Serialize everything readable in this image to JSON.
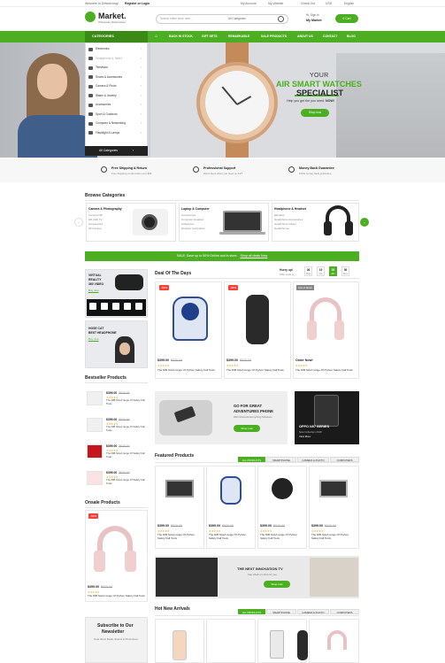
{
  "topbar": {
    "welcome": "Welcome to Default msg!",
    "register": "Register or Login",
    "account": "My Account",
    "wishlist": "My Wishlist",
    "checkout": "Check Out",
    "currency": "USD",
    "language": "English"
  },
  "header": {
    "logo_name": "Market.",
    "logo_tagline": "Wholesale Marketplace",
    "search_placeholder": "Search entire store here...",
    "search_category": "All Categories",
    "greeting": "Hi, Sign In",
    "account_label": "My Market",
    "cart_label": "0 Cart"
  },
  "nav": {
    "categories_label": "CATEGORIES",
    "items": [
      "BACK IN STOCK",
      "GIFT SETS",
      "REMARKABLE",
      "SALE PRODUCTS",
      "ABOUT US",
      "CONTACT",
      "BLOG"
    ]
  },
  "category_menu": {
    "items": [
      "Electronics",
      "Smartphone & Tablet",
      "Television",
      "Shoes & Accessories",
      "Camera & Photo",
      "Watch & Jewelry",
      "Accessories",
      "Sport & Outdoors",
      "Computer & Networking",
      "Flashlight & Lamps"
    ],
    "all_categories": "All Categories"
  },
  "hero": {
    "line1": "YOUR",
    "line2": "AIR SMART WATCHES",
    "line3": "SPECIALIST",
    "tagline_prefix": "Help you get the you need.",
    "tagline_emph": "NOW!",
    "button": "Shop now"
  },
  "features": [
    {
      "icon": "truck-icon",
      "title": "Free Shipping & Return",
      "sub": "Free Shipping on all orders over $99"
    },
    {
      "icon": "headset-icon",
      "title": "Professional Support",
      "sub": "We're there when you need us 24/7"
    },
    {
      "icon": "money-icon",
      "title": "Money Back Guarantee",
      "sub": "100% money back guarantee"
    }
  ],
  "browse": {
    "title": "Browse Categories",
    "boxes": [
      {
        "title": "Camera & Photography",
        "items": [
          "Camera HD",
          "HD LED TV",
          "Accessories",
          "All Camera"
        ]
      },
      {
        "title": "Laptop & Computer",
        "items": [
          "Accessories",
          "Computer Headset",
          "Categories",
          "Desktop Computers"
        ]
      },
      {
        "title": "Headphone & Headset",
        "items": [
          "Elevates",
          "Headphone Accessories",
          "Headphone Cases",
          "Headphones"
        ]
      }
    ]
  },
  "sale_bar": {
    "text": "SALE: Save up to 50% Online and in store.",
    "link": "Shop all deals Now"
  },
  "side_ads": {
    "vr_line1": "VIRTUAL",
    "vr_line2": "REALITY",
    "vr_line3": "360 VIDEO",
    "vr_cta": "Buy now",
    "hp_line1": "HOSE CAT",
    "hp_line2": "BEST HEADPHONE",
    "hp_cta": "Buy now"
  },
  "deal": {
    "title": "Deal Of The Days",
    "hurry": "Hurry up!",
    "offer_ends": "Offer ends in:",
    "countdown": [
      {
        "value": "06",
        "unit": "Days"
      },
      {
        "value": "19",
        "unit": "Hrs"
      },
      {
        "value": "02",
        "unit": "Min"
      },
      {
        "value": "56",
        "unit": "Secs"
      }
    ],
    "products": [
      {
        "badge": "-50%",
        "price": "$399.00",
        "old": "$520.00",
        "name": "The DIB SALA range Of Python Safety Fall Tools",
        "stars": "★★★★★"
      },
      {
        "badge": "-50%",
        "price": "$399.00",
        "old": "$520.00",
        "name": "The DIB SALA range Of Python Safety Fall Tools",
        "stars": "★★★★★"
      },
      {
        "badge": "Out of Stock",
        "price": "Order Now!",
        "old": "",
        "name": "The DIB SALA range Of Python Safety Fall Tools",
        "stars": "★★★★★"
      }
    ]
  },
  "bestseller": {
    "title": "Bestseller Products",
    "items": [
      {
        "price": "$399.00",
        "old": "$520.00",
        "name": "The DIB SALA range Of Safety Fall Tools",
        "stars": "★★★★★"
      },
      {
        "price": "$399.00",
        "old": "$520.00",
        "name": "The DIB SALA range Of Safety Fall Tools",
        "stars": "★★★★★"
      },
      {
        "price": "$399.00",
        "old": "$520.00",
        "name": "The DIB SALA range Of Safety Fall Tools",
        "stars": "★★★★★"
      },
      {
        "price": "$399.00",
        "old": "$520.00",
        "name": "The DIB SALA range Of Safety Fall Tools",
        "stars": "★★★★★"
      }
    ]
  },
  "promo": {
    "line1": "GO FOR GREAT",
    "line2": "ADVENTURES PHONE",
    "sub": "With Motorola Everything Solutions",
    "button": "Shop now",
    "oppo_title": "OPPO N97 SERIES",
    "oppo_sub": "New Collection 2018",
    "oppo_cta": "View More"
  },
  "featured": {
    "title": "Featured Products",
    "tabs": [
      "ALL PRODUCTS",
      "SMARTPHONE",
      "CAMERA & PHOTO",
      "COMPUTERS"
    ],
    "products": [
      {
        "price": "$399.00",
        "old": "$520.00",
        "name": "The DIB SALA range Of Python Safety Fall Tools",
        "stars": "★★★★★"
      },
      {
        "price": "$399.00",
        "old": "$520.00",
        "name": "The DIB SALA range Of Python Safety Fall Tools",
        "stars": "★★★★★"
      },
      {
        "price": "$399.00",
        "old": "$520.00",
        "name": "The DIB SALA range Of Python Safety Fall Tools",
        "stars": "★★★★★"
      },
      {
        "price": "$399.00",
        "old": "$520.00",
        "name": "The DIB SALA range Of Python Safety Fall Tools",
        "stars": "★★★★★"
      }
    ]
  },
  "onsale": {
    "title": "Onsale Products",
    "badge": "-50%",
    "price": "$399.00",
    "old": "$520.00",
    "name": "The DIB SALA range Of Python Safety Fall Tools",
    "stars": "★★★★★"
  },
  "tv_banner": {
    "title": "THE NEXT INNOVATION TV",
    "sub": "See what's in store for you",
    "button": "Shop now"
  },
  "newsletter": {
    "line1": "Subscribe to Our",
    "line2": "Newsletter",
    "sub": "Hear about Deals, Events & Promotions"
  },
  "new_arrivals": {
    "title": "Hot New Arrivals",
    "tabs": [
      "ALL PRODUCTS",
      "SMARTPHONE",
      "CAMERA & PHOTO",
      "COMPUTERS"
    ]
  },
  "colors": {
    "accent": "#4caf22",
    "sale": "#f44336",
    "dark": "#222222"
  }
}
